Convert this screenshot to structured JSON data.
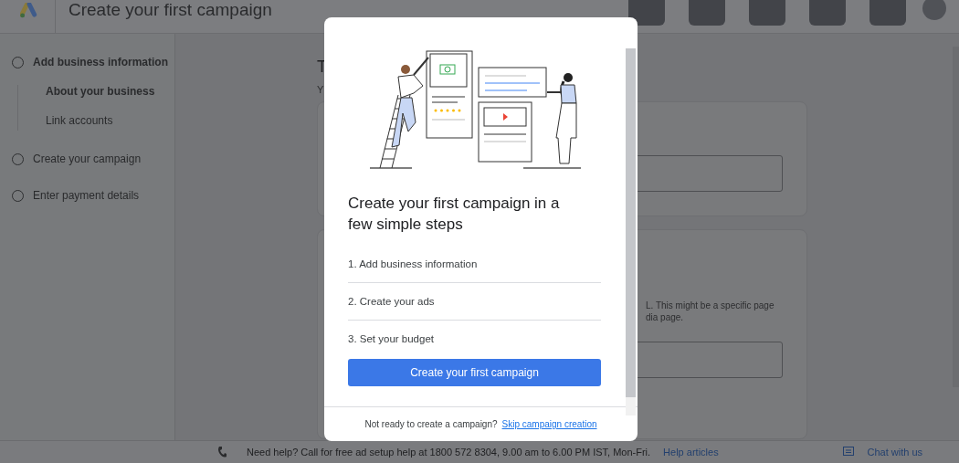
{
  "header": {
    "title": "Create your first campaign"
  },
  "sidebar": {
    "steps": [
      {
        "label": "Add business information",
        "active": true,
        "children": [
          {
            "label": "About your business",
            "selected": true
          },
          {
            "label": "Link accounts",
            "selected": false
          }
        ]
      },
      {
        "label": "Create your campaign",
        "active": false
      },
      {
        "label": "Enter payment details",
        "active": false
      }
    ]
  },
  "main": {
    "heading": "T",
    "subheading": "Y",
    "card_text": "L. This might be a specific page\ndia page."
  },
  "help_bar": {
    "text": "Need help? Call for free ad setup help at 1800 572 8304, 9.00 am to 6.00 PM IST, Mon-Fri.",
    "link": "Help articles",
    "chat": "Chat with us"
  },
  "dialog": {
    "title": "Create your first campaign in a few simple steps",
    "steps": [
      "1. Add business information",
      "2. Create your ads",
      "3. Set your budget"
    ],
    "button": "Create your first campaign",
    "footer_text": "Not ready to create a campaign?",
    "footer_link": "Skip campaign creation"
  }
}
